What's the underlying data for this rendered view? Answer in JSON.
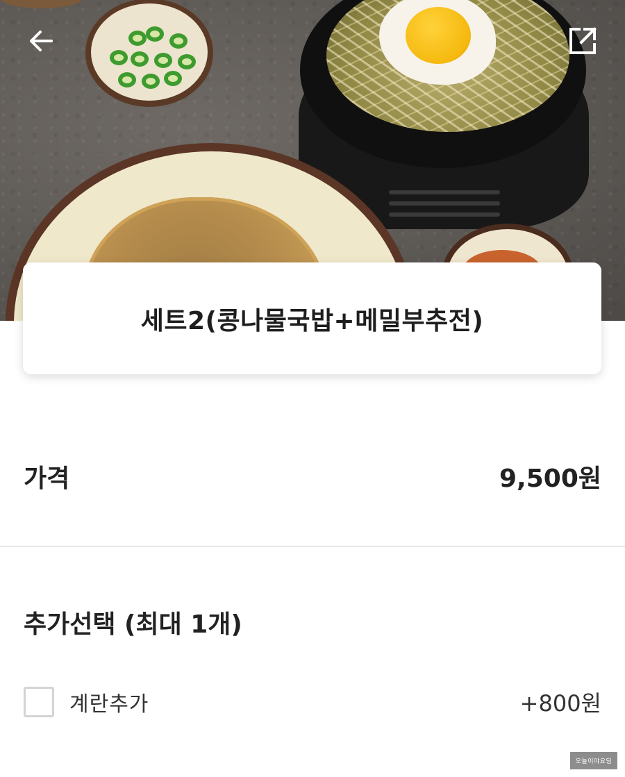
{
  "header": {
    "back_icon": "arrow-left-icon",
    "share_icon": "external-link-icon"
  },
  "hero": {
    "alt": "콩나물국밥과 메밀부추전 사진"
  },
  "product": {
    "title": "세트2(콩나물국밥+메밀부추전)"
  },
  "price": {
    "label": "가격",
    "value": "9,500원"
  },
  "options": {
    "title": "추가선택 (최대 1개)",
    "items": [
      {
        "name": "계란추가",
        "price": "+800원",
        "checked": false
      }
    ]
  },
  "watermark": "오늘이야요딩",
  "colors": {
    "text": "#1c1c1c",
    "divider": "#e6e6e6",
    "checkbox_border": "#d4d4d4"
  }
}
